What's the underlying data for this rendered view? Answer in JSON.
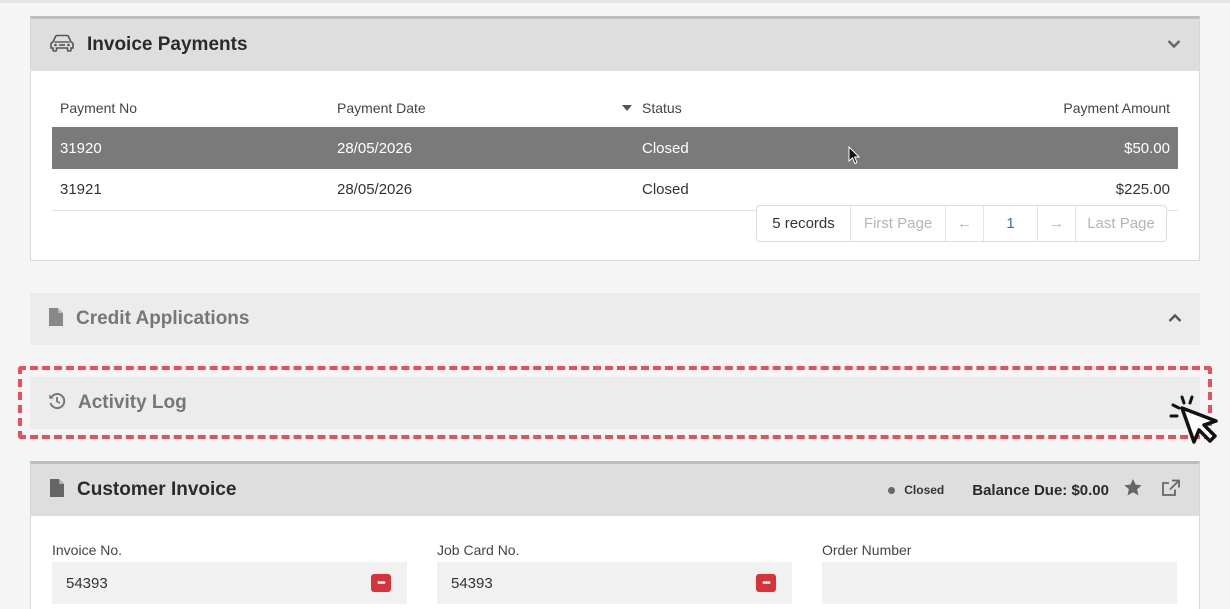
{
  "payments": {
    "title": "Invoice Payments",
    "columns": [
      "Payment No",
      "Payment Date",
      "Status",
      "Payment Amount"
    ],
    "rows": [
      {
        "no": "31920",
        "date": "28/05/2026",
        "status": "Closed",
        "amount": "$50.00"
      },
      {
        "no": "31921",
        "date": "28/05/2026",
        "status": "Closed",
        "amount": "$225.00"
      }
    ],
    "pager": {
      "records": "5 records",
      "first": "First Page",
      "prev": "←",
      "page": "1",
      "next": "→",
      "last": "Last Page"
    }
  },
  "credit": {
    "title": "Credit Applications"
  },
  "activity": {
    "title": "Activity Log"
  },
  "invoice": {
    "title": "Customer Invoice",
    "status": "Closed",
    "balance": "Balance Due: $0.00",
    "fields": [
      {
        "label": "Invoice No.",
        "value": "54393"
      },
      {
        "label": "Job Card No.",
        "value": "54393"
      },
      {
        "label": "Order Number",
        "value": ""
      }
    ]
  },
  "icons": [
    "car-icon",
    "chevron-down-icon",
    "document-icon",
    "chevron-up-icon",
    "history-icon",
    "star-icon",
    "external-link-icon",
    "dots-icon",
    "mouse-cursor-icon",
    "click-cursor-icon"
  ],
  "colors": {
    "accent_red": "#e94e5a",
    "selected_row": "#7a7a7a",
    "link_blue": "#3f6fa8"
  }
}
